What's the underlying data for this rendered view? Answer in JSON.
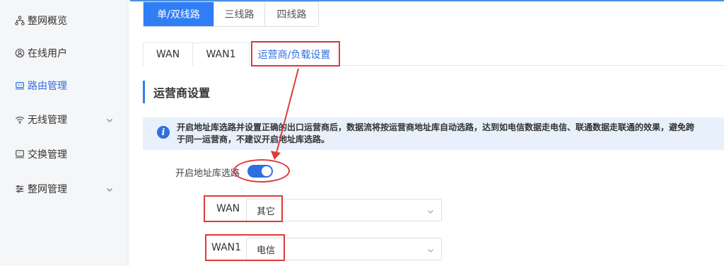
{
  "sidebar": {
    "items": [
      {
        "label": "整网概览",
        "icon": "topology-icon"
      },
      {
        "label": "在线用户",
        "icon": "user-icon"
      },
      {
        "label": "路由管理",
        "icon": "router-icon"
      },
      {
        "label": "无线管理",
        "icon": "wifi-icon"
      },
      {
        "label": "交换管理",
        "icon": "switch-icon"
      },
      {
        "label": "整网管理",
        "icon": "settings-sliders-icon"
      }
    ],
    "active_label": "路由管理"
  },
  "route_tabs": [
    "单/双线路",
    "三线路",
    "四线路"
  ],
  "wan_tabs": [
    "WAN",
    "WAN1",
    "运营商/负载设置"
  ],
  "section_title": "运营商设置",
  "info": {
    "line1": "开启地址库选路并设置正确的出口运营商后，数据流将按运营商地址库自动选路，达到如电信数据走电信、联通数据走联通的效果，避免跨",
    "line2": "于同一运营商，不建议开启地址库选路。"
  },
  "address_routing": {
    "label": "开启地址库选路",
    "enabled": true
  },
  "carriers": [
    {
      "label": "WAN",
      "value": "其它"
    },
    {
      "label": "WAN1",
      "value": "电信"
    }
  ],
  "colors": {
    "accent": "#2f7ef5",
    "annotation_red": "#e03a3a",
    "info_bg": "#e8f1fb"
  }
}
